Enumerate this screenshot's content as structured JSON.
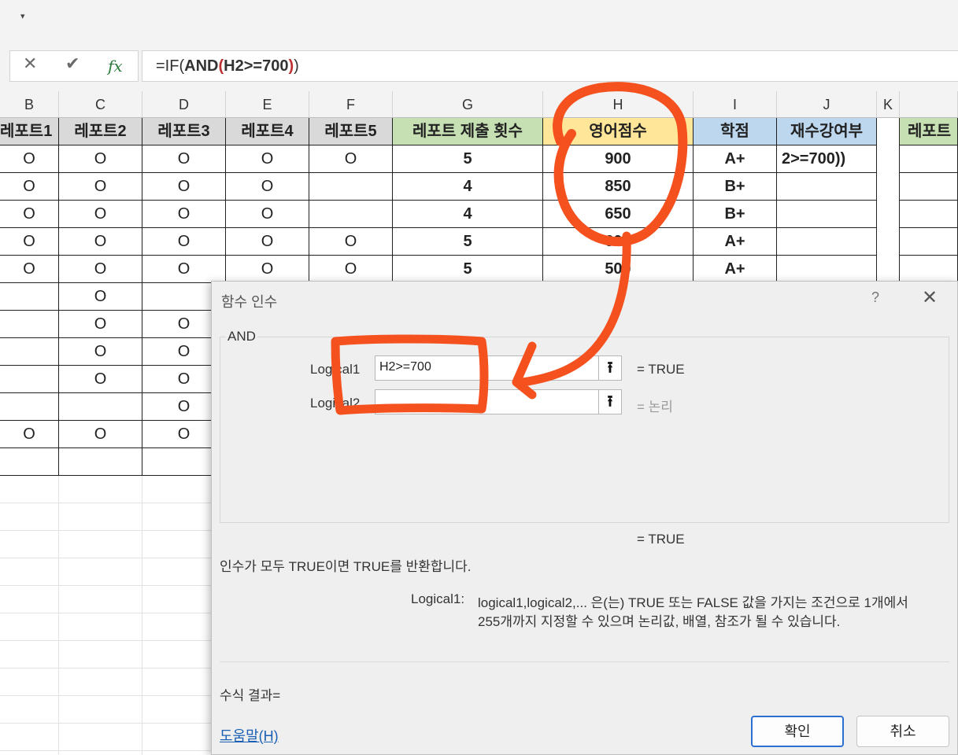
{
  "formula_bar": {
    "cancel_icon": "✕",
    "enter_icon": "✔",
    "fx_label": "fx",
    "formula_parts": [
      "=IF(",
      "AND",
      "(",
      "H2>=700",
      ")",
      ")"
    ]
  },
  "columns": [
    "B",
    "C",
    "D",
    "E",
    "F",
    "G",
    "H",
    "I",
    "J",
    "K",
    ""
  ],
  "headers": [
    "레포트1",
    "레포트2",
    "레포트3",
    "레포트4",
    "레포트5",
    "레포트 제출 횟수",
    "영어점수",
    "학점",
    "재수강여부",
    "",
    "레포트"
  ],
  "header_colors": {
    "reports": "#d9d9d9",
    "count": "#c6e0b4",
    "english": "#ffe699",
    "grade": "#bdd7ee",
    "retake": "#bdd7ee",
    "extra": "#c6e0b4"
  },
  "rows": [
    [
      "O",
      "O",
      "O",
      "O",
      "O",
      "5",
      "900",
      "A+",
      "2>=700))"
    ],
    [
      "O",
      "O",
      "O",
      "O",
      "",
      "4",
      "850",
      "B+",
      ""
    ],
    [
      "O",
      "O",
      "O",
      "O",
      "",
      "4",
      "650",
      "B+",
      ""
    ],
    [
      "O",
      "O",
      "O",
      "O",
      "O",
      "5",
      "600",
      "A+",
      ""
    ],
    [
      "O",
      "O",
      "O",
      "O",
      "O",
      "5",
      "500",
      "A+",
      ""
    ],
    [
      "",
      "O",
      "",
      "",
      "",
      "",
      "",
      "",
      ""
    ],
    [
      "",
      "O",
      "O",
      "",
      "",
      "",
      "",
      "",
      ""
    ],
    [
      "",
      "O",
      "O",
      "",
      "",
      "",
      "",
      "",
      ""
    ],
    [
      "",
      "O",
      "O",
      "",
      "",
      "",
      "",
      "",
      ""
    ],
    [
      "",
      "",
      "O",
      "",
      "",
      "",
      "",
      "",
      ""
    ],
    [
      "O",
      "O",
      "O",
      "",
      "",
      "",
      "",
      "",
      ""
    ],
    [
      "",
      "",
      "",
      "",
      "",
      "",
      "",
      "",
      ""
    ]
  ],
  "dialog": {
    "title": "함수 인수",
    "help_glyph": "?",
    "close_glyph": "✕",
    "function_name": "AND",
    "arg1_label": "Logical1",
    "arg1_value": "H2>=700",
    "arg1_result": "=   TRUE",
    "arg2_label": "Logical2",
    "arg2_value": "",
    "arg2_result": "=   논리",
    "overall_result": "=   TRUE",
    "description": "인수가 모두 TRUE이면 TRUE를 반환합니다.",
    "param_name": "Logical1:",
    "param_desc_line1": "logical1,logical2,... 은(는) TRUE 또는 FALSE 값을 가지는 조건으로 1개에서",
    "param_desc_line2": "255개까지 지정할 수 있으며 논리값, 배열, 참조가 될 수 있습니다.",
    "formula_result_label": "수식 결과=",
    "help_link": "도움말(H)",
    "ok_label": "확인",
    "cancel_label": "취소"
  },
  "annotation_color": "#f4511e"
}
